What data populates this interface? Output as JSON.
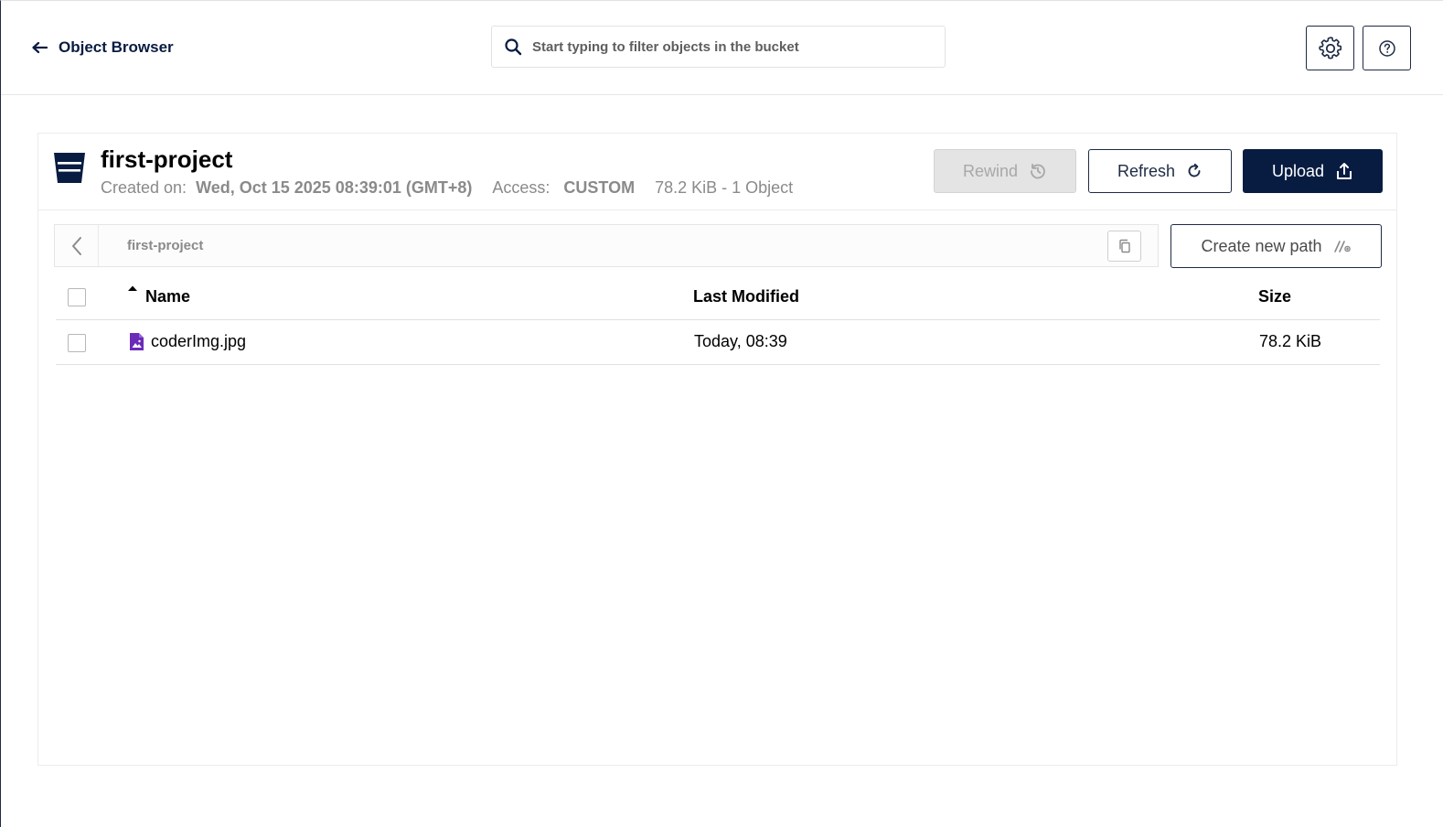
{
  "header": {
    "back_label": "Object Browser",
    "search_placeholder": "Start typing to filter objects in the bucket"
  },
  "bucket": {
    "name": "first-project",
    "created_label": "Created on:",
    "created_value": "Wed, Oct 15 2025 08:39:01 (GMT+8)",
    "access_label": "Access:",
    "access_value": "CUSTOM",
    "summary": "78.2 KiB - 1 Object"
  },
  "actions": {
    "rewind_label": "Rewind",
    "refresh_label": "Refresh",
    "upload_label": "Upload",
    "create_path_label": "Create new path"
  },
  "path": {
    "current": "first-project"
  },
  "table": {
    "columns": {
      "name": "Name",
      "last_modified": "Last Modified",
      "size": "Size"
    },
    "rows": [
      {
        "name": "coderImg.jpg",
        "last_modified": "Today, 08:39",
        "size": "78.2 KiB",
        "icon": "image-file-icon"
      }
    ]
  },
  "colors": {
    "primary": "#081c42",
    "file_icon": "#6b2bb8",
    "muted_text": "#8a8a8a",
    "disabled_button": "#e4e4e4"
  }
}
